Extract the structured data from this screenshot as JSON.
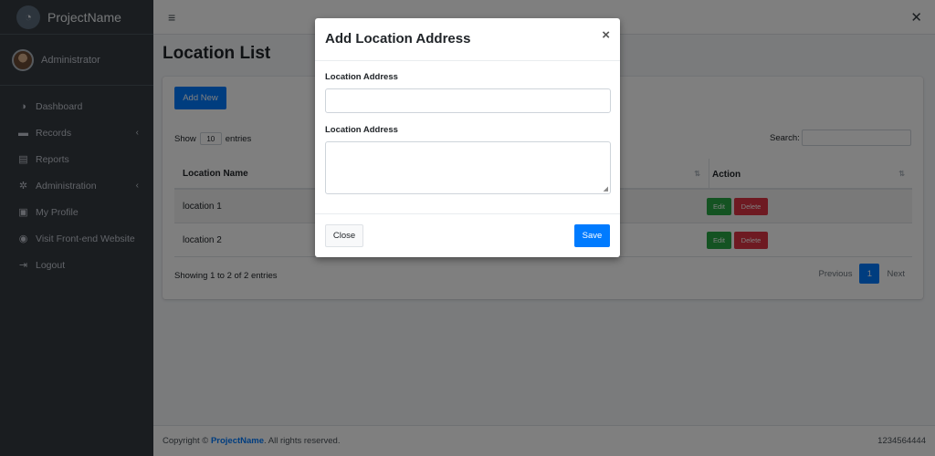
{
  "brand": {
    "name": "ProjectName",
    "logo_icon": "logo-icon"
  },
  "user": {
    "name": "Administrator"
  },
  "sidebar": {
    "items": [
      {
        "label": "Dashboard",
        "icon": "dashboard-icon",
        "glyph": "◑"
      },
      {
        "label": "Records",
        "icon": "folder-icon",
        "glyph": "▬",
        "caret": "‹"
      },
      {
        "label": "Reports",
        "icon": "chart-icon",
        "glyph": "▤"
      },
      {
        "label": "Administration",
        "icon": "cogs-icon",
        "glyph": "✲",
        "caret": "‹"
      },
      {
        "label": "My Profile",
        "icon": "id-card-icon",
        "glyph": "▣"
      },
      {
        "label": "Visit Front-end Website",
        "icon": "globe-icon",
        "glyph": "◉"
      },
      {
        "label": "Logout",
        "icon": "logout-icon",
        "glyph": "⇥"
      }
    ]
  },
  "topbar": {
    "menu_glyph": "≡",
    "expand_glyph": "✕"
  },
  "page": {
    "title": "Location List"
  },
  "toolbar": {
    "add_label": "Add New"
  },
  "table_controls": {
    "show_label": "Show",
    "entries_value": "10",
    "entries_label": "entries",
    "search_label": "Search:"
  },
  "table": {
    "headers": {
      "name": "Location Name",
      "action": "Action"
    },
    "rows": [
      {
        "name": "location 1",
        "edit": "Edit",
        "delete": "Delete"
      },
      {
        "name": "location 2",
        "edit": "Edit",
        "delete": "Delete"
      }
    ],
    "info": "Showing 1 to 2 of 2 entries"
  },
  "pagination": {
    "previous": "Previous",
    "current": "1",
    "next": "Next"
  },
  "footer": {
    "copyright_prefix": "Copyright ©",
    "brand": "ProjectName",
    "copyright_suffix": ". All rights reserved.",
    "right": "1234564444"
  },
  "modal": {
    "title": "Add Location Address",
    "close_glyph": "×",
    "field1_label": "Location Address",
    "field1_value": "",
    "field2_label": "Location Address",
    "field2_value": "",
    "close_label": "Close",
    "save_label": "Save"
  },
  "colors": {
    "primary": "#007bff",
    "success": "#28a745",
    "danger": "#dc3545",
    "sidebar": "#343a40"
  }
}
